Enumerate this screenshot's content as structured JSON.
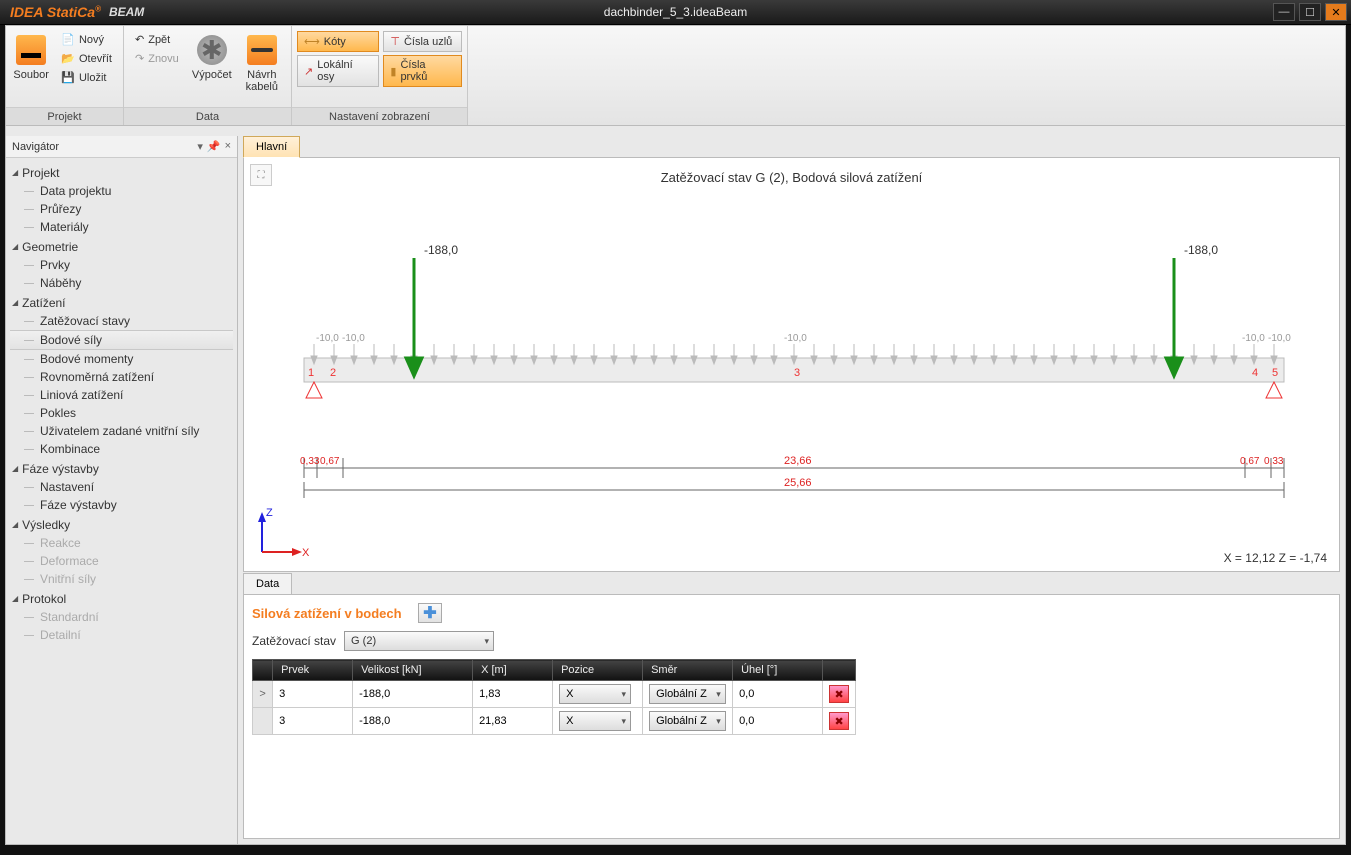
{
  "titlebar": {
    "brand": "IDEA StatiCa",
    "product": "BEAM",
    "filename": "dachbinder_5_3.ideaBeam"
  },
  "ribbon": {
    "groups": {
      "projekt": {
        "label": "Projekt",
        "soubor": "Soubor",
        "novy": "Nový",
        "otevrit": "Otevřít",
        "ulozit": "Uložit"
      },
      "data": {
        "label": "Data",
        "zpet": "Zpět",
        "znovu": "Znovu",
        "vypocet": "Výpočet",
        "navrh_l1": "Návrh",
        "navrh_l2": "kabelů"
      },
      "zobraz": {
        "label": "Nastavení zobrazení",
        "koty": "Kóty",
        "lokalni": "Lokální osy",
        "cisla_uzlu": "Čísla uzlů",
        "cisla_prvku": "Čísla prvků"
      }
    }
  },
  "navigator": {
    "title": "Navigátor",
    "groups": [
      {
        "title": "Projekt",
        "items": [
          "Data projektu",
          "Průřezy",
          "Materiály"
        ]
      },
      {
        "title": "Geometrie",
        "items": [
          "Prvky",
          "Náběhy"
        ]
      },
      {
        "title": "Zatížení",
        "items": [
          "Zatěžovací stavy",
          "Bodové síly",
          "Bodové momenty",
          "Rovnoměrná zatížení",
          "Liniová zatížení",
          "Pokles",
          "Uživatelem zadané vnitřní síly",
          "Kombinace"
        ],
        "selected": "Bodové síly"
      },
      {
        "title": "Fáze výstavby",
        "items": [
          "Nastavení",
          "Fáze výstavby"
        ]
      },
      {
        "title": "Výsledky",
        "items": [
          "Reakce",
          "Deformace",
          "Vnitřní síly"
        ],
        "disabled": true
      },
      {
        "title": "Protokol",
        "items": [
          "Standardní",
          "Detailní"
        ],
        "disabled": true
      }
    ]
  },
  "main_tab": "Hlavní",
  "viz": {
    "title": "Zatěžovací stav G (2), Bodová silová zatížení",
    "force_label_left": "-188,0",
    "force_label_right": "-188,0",
    "dist_left_a": "-10,0",
    "dist_left_b": "-10,0",
    "dist_mid": "-10,0",
    "dist_right_a": "-10,0",
    "dist_right_b": "-10,0",
    "dim_a": "0,33",
    "dim_b": "0,67",
    "dim_c": "23,66",
    "dim_d": "0,67",
    "dim_e": "0,33",
    "dim_total": "25,66",
    "nodes": [
      "1",
      "2",
      "3",
      "4",
      "5"
    ],
    "axis_z": "Z",
    "axis_x": "X",
    "coord": "X = 12,12  Z = -1,74"
  },
  "data_tab": "Data",
  "datapanel": {
    "title": "Silová zatížení v bodech",
    "loadcase_label": "Zatěžovací stav",
    "loadcase_value": "G (2)",
    "columns": [
      "Prvek",
      "Velikost [kN]",
      "X [m]",
      "Pozice",
      "Směr",
      "Úhel [°]"
    ],
    "rows": [
      {
        "prvek": "3",
        "velikost": "-188,0",
        "x": "1,83",
        "pozice": "X",
        "smer": "Globální Z",
        "uhel": "0,0"
      },
      {
        "prvek": "3",
        "velikost": "-188,0",
        "x": "21,83",
        "pozice": "X",
        "smer": "Globální Z",
        "uhel": "0,0"
      }
    ]
  }
}
